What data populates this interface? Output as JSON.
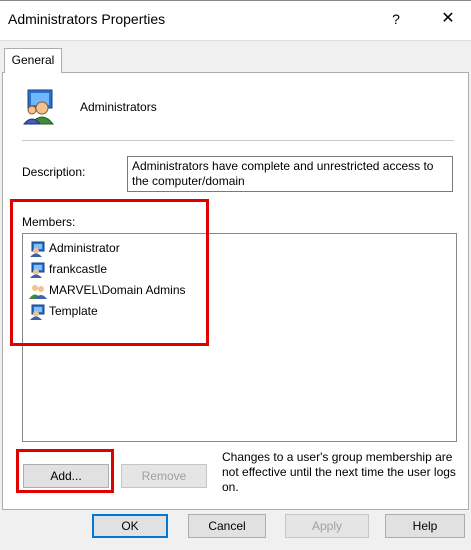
{
  "window": {
    "title": "Administrators Properties",
    "help_glyph": "?",
    "close_glyph": "✕"
  },
  "tabs": [
    {
      "label": "General",
      "selected": true
    }
  ],
  "group": {
    "name": "Administrators",
    "icon": "group-users-icon"
  },
  "description": {
    "label": "Description:",
    "value": "Administrators have complete and unrestricted access to the computer/domain"
  },
  "members": {
    "label": "Members:",
    "items": [
      {
        "name": "Administrator",
        "icon": "user-icon"
      },
      {
        "name": "frankcastle",
        "icon": "user-icon"
      },
      {
        "name": "MARVEL\\Domain Admins",
        "icon": "group-icon"
      },
      {
        "name": "Template",
        "icon": "user-icon"
      }
    ]
  },
  "actions": {
    "add_label": "Add...",
    "remove_label": "Remove",
    "remove_enabled": false,
    "note": "Changes to a user's group membership are not effective until the next time the user logs on."
  },
  "footer": {
    "ok_label": "OK",
    "cancel_label": "Cancel",
    "apply_label": "Apply",
    "apply_enabled": false,
    "help_label": "Help"
  },
  "colors": {
    "highlight": "#e00000",
    "default_button_border": "#0078d7",
    "dialog_background": "#f0f0f0"
  }
}
